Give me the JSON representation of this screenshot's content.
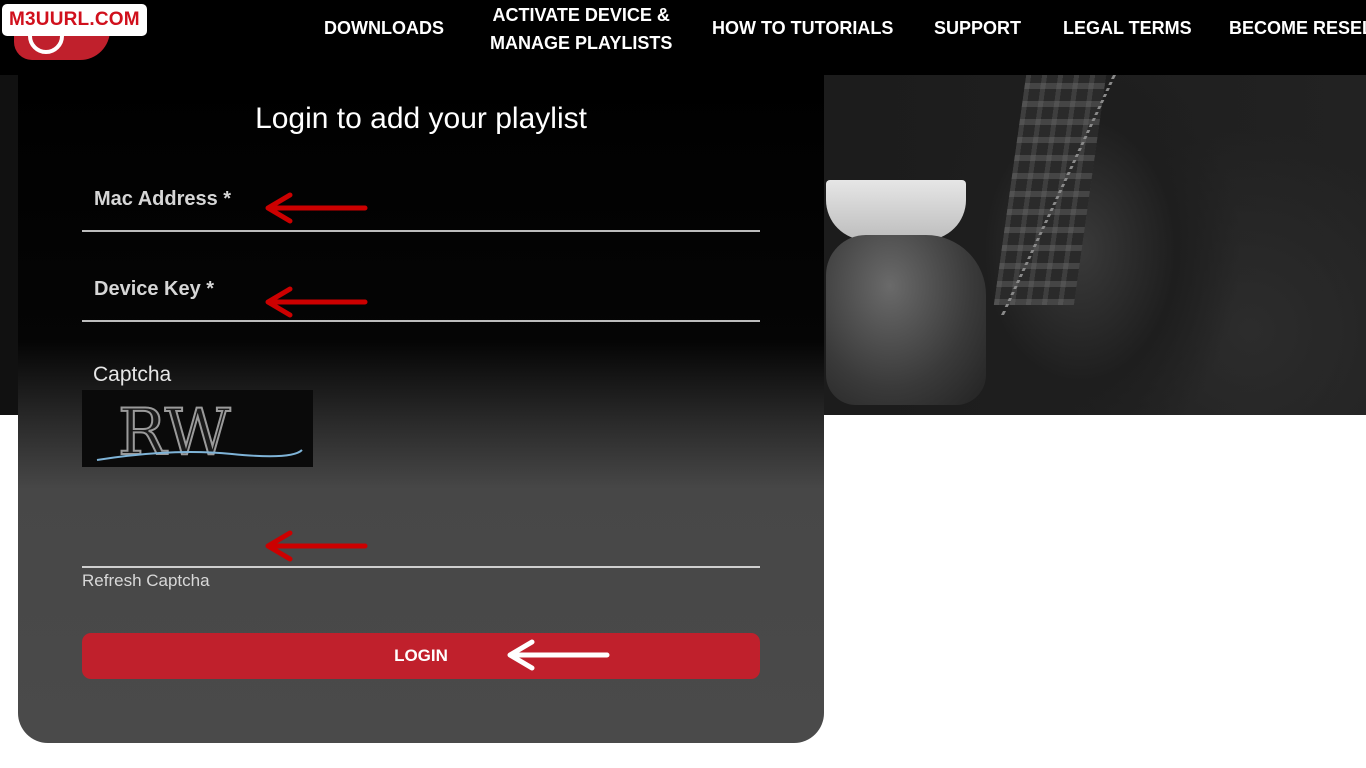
{
  "brand": {
    "name": "M3UURL.COM"
  },
  "nav": {
    "items": [
      {
        "label": "DOWNLOADS"
      },
      {
        "label_line1": "ACTIVATE DEVICE &",
        "label_line2": "MANAGE PLAYLISTS"
      },
      {
        "label": "HOW TO TUTORIALS"
      },
      {
        "label": "SUPPORT"
      },
      {
        "label": "LEGAL TERMS"
      },
      {
        "label": "BECOME RESELLER"
      }
    ]
  },
  "login_form": {
    "title": "Login to add your playlist",
    "mac_address": {
      "label": "Mac Address *",
      "value": ""
    },
    "device_key": {
      "label": "Device Key *",
      "value": ""
    },
    "captcha": {
      "label": "Captcha",
      "image_text": "RW",
      "input_value": ""
    },
    "refresh_label": "Refresh Captcha",
    "submit_label": "LOGIN"
  },
  "annotations": {
    "arrow_color_primary": "#cc0000",
    "arrow_color_login": "#ffffff"
  },
  "colors": {
    "accent": "#c0202c",
    "nav_bg": "#000000",
    "card_bg": "#4a4a4a"
  }
}
